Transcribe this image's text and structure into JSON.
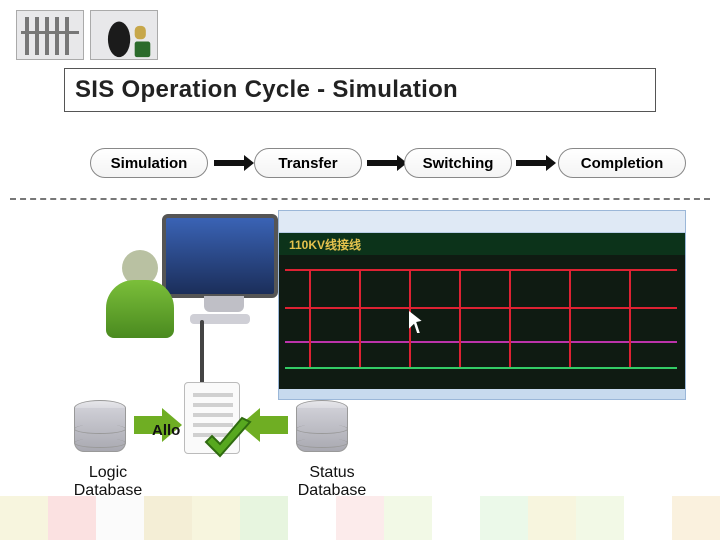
{
  "title": "SIS  Operation Cycle - Simulation",
  "stages": {
    "s1": "Simulation",
    "s2": "Transfer",
    "s3": "Switching",
    "s4": "Completion"
  },
  "app_banner": "110KV线接线",
  "allow_label": "Allo",
  "captions": {
    "logic_db": "Logic\nDatabase",
    "status_db": "Status\nDatabase"
  },
  "tile_colors": [
    "#e8e3a1",
    "#f4a9a9",
    "#f4f4f4",
    "#e0cf8a",
    "#e8e3a1",
    "#b9e2a3",
    "#ffffff",
    "#f7c6c6",
    "#d9efb6",
    "#ffffff",
    "#c7efc0",
    "#e8e3a1",
    "#d9efb6",
    "#ffffff",
    "#f0d7a0"
  ]
}
